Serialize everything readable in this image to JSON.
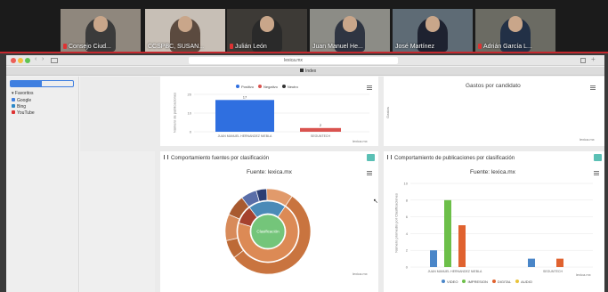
{
  "meeting": {
    "participants": [
      {
        "name": "Consejo Ciud...",
        "muted": true,
        "bg": "#8f877d",
        "shirt": "#3b3b3b"
      },
      {
        "name": "CCSPBC, SUSAN...",
        "muted": false,
        "bg": "#c7bfb6",
        "shirt": "#5b4a3f"
      },
      {
        "name": "Julián León",
        "muted": true,
        "bg": "#3d3a36",
        "shirt": "#2a2a2a"
      },
      {
        "name": "Juan Manuel He...",
        "muted": false,
        "bg": "#8c8c86",
        "shirt": "#2f3542"
      },
      {
        "name": "José Martínez",
        "muted": false,
        "bg": "#5e6b75",
        "shirt": "#1e2230"
      },
      {
        "name": "Adrián García L...",
        "muted": true,
        "bg": "#6b6b63",
        "shirt": "#223046"
      }
    ]
  },
  "browser": {
    "url": "lexica.mx",
    "tab_label": "Index",
    "sidebar": {
      "seg_a": "",
      "seg_b": "",
      "favorites_header": "Favoritos",
      "favorites": [
        {
          "label": "Google",
          "color": "#3f7fe0"
        },
        {
          "label": "Bing",
          "color": "#2b88c9"
        },
        {
          "label": "YouTube",
          "color": "#d33"
        }
      ]
    }
  },
  "panels": {
    "top_left": {
      "legend": [
        {
          "label": "Positivo",
          "color": "#2f6fe0"
        },
        {
          "label": "Negativo",
          "color": "#d9534f"
        },
        {
          "label": "Neutro",
          "color": "#333333"
        }
      ],
      "ylabel": "Número de publicaciones",
      "footer": "lexica.mx"
    },
    "top_right": {
      "title": "Gastos por candidato",
      "ylabel": "Gastos",
      "footer": "lexica.mx"
    },
    "bottom_left": {
      "title": "Comportamiento fuentes por clasificación",
      "subtitle": "Fuente: lexica.mx",
      "center_label": "Clasificación",
      "footer": "lexica.mx"
    },
    "bottom_right": {
      "title": "Comportamiento de publicaciones por clasificación",
      "subtitle": "Fuente: lexica.mx",
      "ylabel": "Número promedio por Clasificaciones",
      "footer": "lexica.mx"
    }
  },
  "chart_data": [
    {
      "type": "bar",
      "categories": [
        "JUAN MANUEL HERNANDEZ NIEBLA",
        "SEGUNTECH"
      ],
      "series": [
        {
          "name": "Positivo",
          "values": [
            17,
            2
          ],
          "colors": [
            "#2f6fe0",
            "#d9534f"
          ]
        }
      ],
      "ylim": [
        0,
        20
      ],
      "yticks": [
        0,
        10,
        20
      ],
      "ylabel": "Número de publicaciones"
    },
    {
      "type": "pie",
      "title": "Comportamiento fuentes por clasificación",
      "center": "Clasificación",
      "slices": [
        {
          "label": "inner",
          "value": 1,
          "color": "#74c57a"
        },
        {
          "label": "ring1",
          "value": 70,
          "color": "#dc8a55"
        },
        {
          "label": "ring1b",
          "value": 10,
          "color": "#a5412e"
        },
        {
          "label": "ring1c",
          "value": 20,
          "color": "#4b8ab7"
        }
      ]
    },
    {
      "type": "bar",
      "title": "Comportamiento de publicaciones por clasificación",
      "categories": [
        "JUAN MANUEL HERNANDEZ NIEBLA",
        "SEGUNTECH"
      ],
      "series": [
        {
          "name": "VIDEO",
          "color": "#4a86c8",
          "values": [
            2,
            1
          ]
        },
        {
          "name": "IMPRESION",
          "color": "#6cbf49",
          "values": [
            8,
            0
          ]
        },
        {
          "name": "DIGITAL",
          "color": "#e0622f",
          "values": [
            5,
            1
          ]
        },
        {
          "name": "AUDIO",
          "color": "#e8c33a",
          "values": [
            0,
            0
          ]
        }
      ],
      "ylim": [
        0,
        10
      ],
      "yticks": [
        0,
        2,
        4,
        6,
        8,
        10
      ],
      "ylabel": "Número promedio por Clasificaciones"
    }
  ]
}
